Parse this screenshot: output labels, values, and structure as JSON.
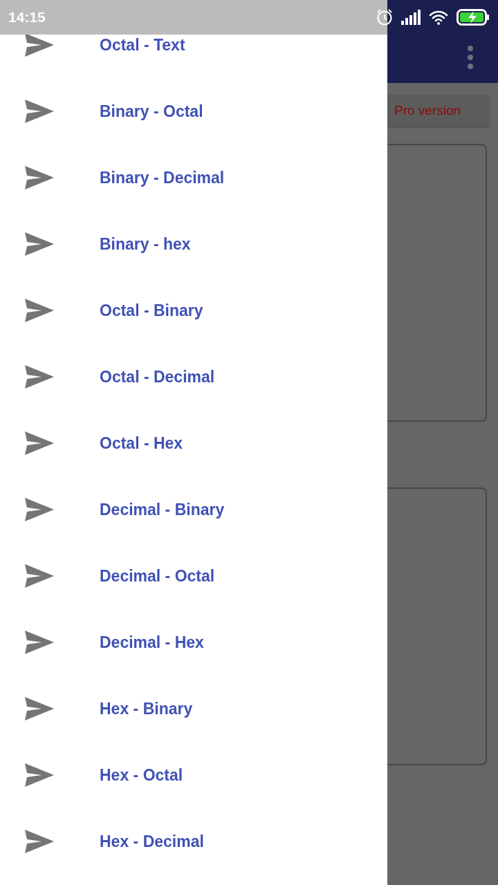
{
  "status_bar": {
    "time": "14:15"
  },
  "drawer": {
    "items": [
      {
        "label": "Octal - Text"
      },
      {
        "label": "Binary - Octal"
      },
      {
        "label": "Binary - Decimal"
      },
      {
        "label": "Binary - hex"
      },
      {
        "label": "Octal - Binary"
      },
      {
        "label": "Octal - Decimal"
      },
      {
        "label": "Octal - Hex"
      },
      {
        "label": "Decimal - Binary"
      },
      {
        "label": "Decimal - Octal"
      },
      {
        "label": "Decimal - Hex"
      },
      {
        "label": "Hex - Binary"
      },
      {
        "label": "Hex - Octal"
      },
      {
        "label": "Hex - Decimal"
      }
    ]
  },
  "background_app": {
    "pro_button": "Pro version"
  }
}
